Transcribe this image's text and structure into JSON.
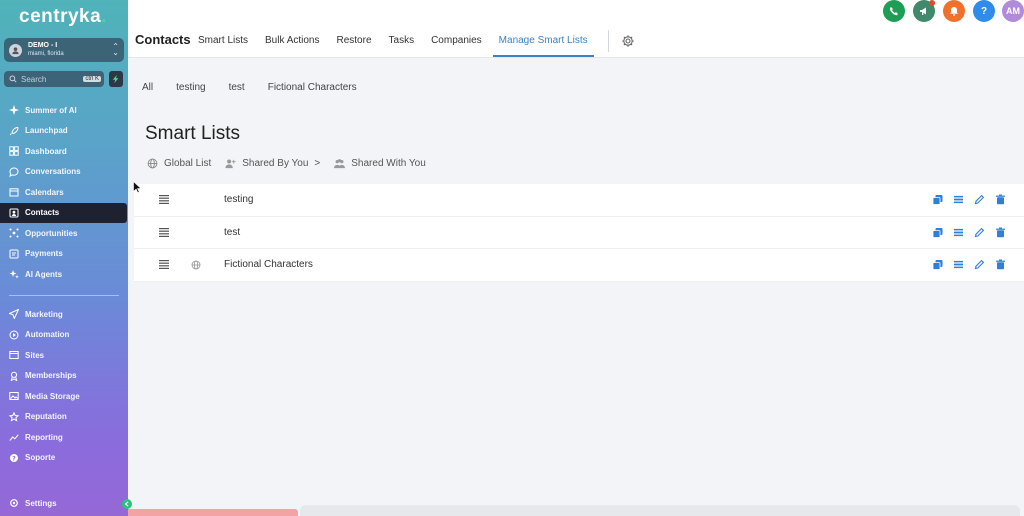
{
  "sidebar": {
    "brand": {
      "name": "centryka",
      "dot": "."
    },
    "account": {
      "name": "DEMO - I",
      "location": "miami, florida"
    },
    "search": {
      "placeholder": "Search",
      "shortcut": "ctrl K"
    },
    "items_top": [
      {
        "label": "Summer of AI",
        "icon": "sparkle-icon"
      },
      {
        "label": "Launchpad",
        "icon": "rocket-icon"
      },
      {
        "label": "Dashboard",
        "icon": "dashboard-icon"
      },
      {
        "label": "Conversations",
        "icon": "chat-icon"
      },
      {
        "label": "Calendars",
        "icon": "calendar-icon"
      },
      {
        "label": "Contacts",
        "icon": "contacts-icon",
        "active": true
      },
      {
        "label": "Opportunities",
        "icon": "opportunities-icon"
      },
      {
        "label": "Payments",
        "icon": "payments-icon"
      },
      {
        "label": "AI Agents",
        "icon": "ai-agents-icon"
      }
    ],
    "items_bottom": [
      {
        "label": "Marketing",
        "icon": "send-icon"
      },
      {
        "label": "Automation",
        "icon": "automation-icon"
      },
      {
        "label": "Sites",
        "icon": "sites-icon"
      },
      {
        "label": "Memberships",
        "icon": "memberships-icon"
      },
      {
        "label": "Media Storage",
        "icon": "media-icon"
      },
      {
        "label": "Reputation",
        "icon": "star-icon"
      },
      {
        "label": "Reporting",
        "icon": "reporting-icon"
      },
      {
        "label": "Soporte",
        "icon": "support-icon"
      }
    ],
    "settings": {
      "label": "Settings",
      "icon": "gear-icon"
    }
  },
  "header": {
    "title": "Contacts",
    "tabs": [
      {
        "label": "Smart Lists"
      },
      {
        "label": "Bulk Actions"
      },
      {
        "label": "Restore"
      },
      {
        "label": "Tasks"
      },
      {
        "label": "Companies"
      },
      {
        "label": "Manage Smart Lists",
        "active": true
      }
    ],
    "top_icons": [
      {
        "name": "phone-icon",
        "color": "#1e9e55"
      },
      {
        "name": "megaphone-icon",
        "color": "#3f8a6a"
      },
      {
        "name": "bell-icon",
        "color": "#f0712c"
      },
      {
        "name": "help-icon",
        "color": "#2f8ceb",
        "text": "?"
      },
      {
        "name": "avatar",
        "color": "#b18ad9",
        "text": "AM"
      }
    ]
  },
  "filters": [
    "All",
    "testing",
    "test",
    "Fictional Characters"
  ],
  "main": {
    "title": "Smart Lists",
    "scopes": [
      {
        "label": "Global List",
        "icon": "globe-icon"
      },
      {
        "label": "Shared By You",
        "icon": "user-plus-icon",
        "suffix": ">"
      },
      {
        "label": "Shared With You",
        "icon": "users-icon"
      }
    ],
    "rows": [
      {
        "label": "testing",
        "global": false
      },
      {
        "label": "test",
        "global": false
      },
      {
        "label": "Fictional Characters",
        "global": true
      }
    ],
    "row_actions": [
      "copy-icon",
      "list-icon",
      "edit-icon",
      "delete-icon"
    ],
    "accent": "#2f7fd8"
  }
}
